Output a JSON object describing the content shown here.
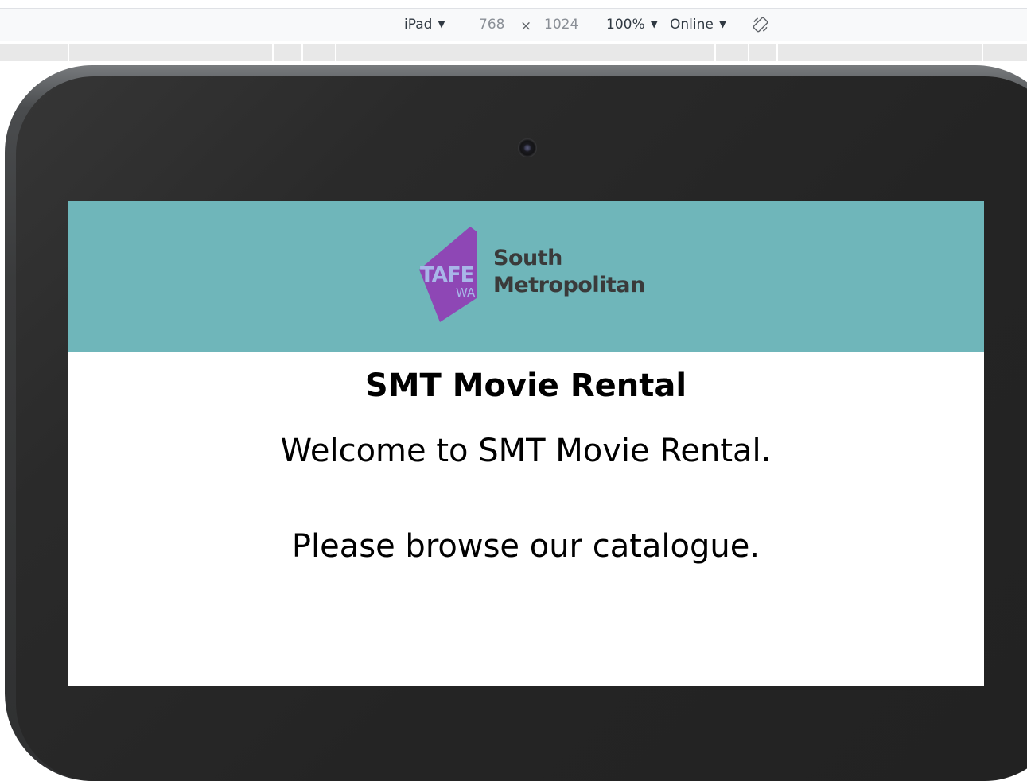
{
  "devtools": {
    "device": "iPad",
    "width": "768",
    "times": "×",
    "height": "1024",
    "zoom": "100%",
    "throttling": "Online",
    "rotate_icon": "rotate-icon"
  },
  "page": {
    "logo": {
      "mark_top": "TAFE",
      "mark_bottom": "WA",
      "line1": "South",
      "line2": "Metropolitan"
    },
    "title": "SMT Movie Rental",
    "welcome": "Welcome to SMT Movie Rental.",
    "browse": "Please browse our catalogue."
  },
  "colors": {
    "header_bg": "#6fb6ba",
    "logo_purple": "#8e47b5",
    "device_frame": "#2a2a2a"
  }
}
